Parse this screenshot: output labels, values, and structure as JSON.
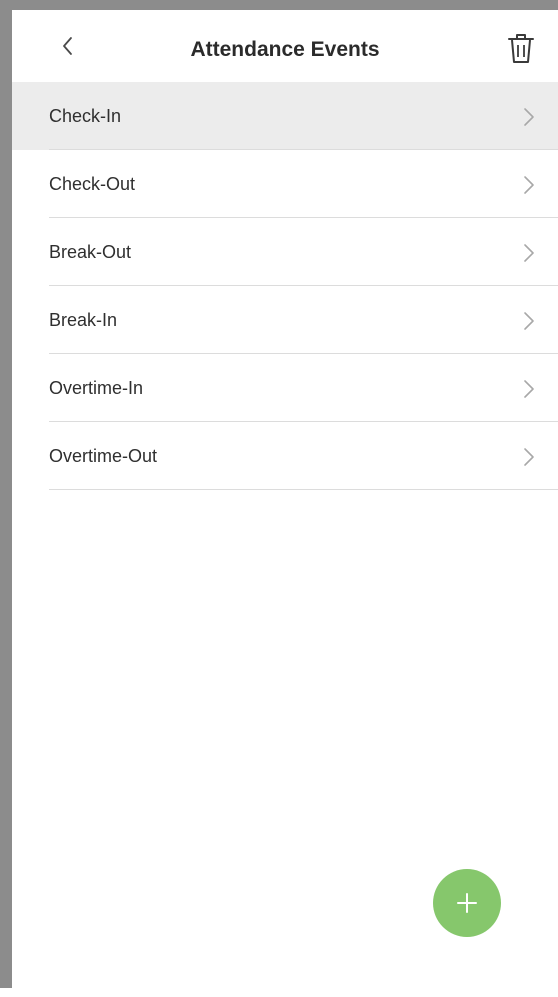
{
  "header": {
    "title": "Attendance Events",
    "back_icon": "chevron-left-icon",
    "delete_icon": "trash-icon"
  },
  "events": [
    {
      "label": "Check-In",
      "selected": true
    },
    {
      "label": "Check-Out",
      "selected": false
    },
    {
      "label": "Break-Out",
      "selected": false
    },
    {
      "label": "Break-In",
      "selected": false
    },
    {
      "label": "Overtime-In",
      "selected": false
    },
    {
      "label": "Overtime-Out",
      "selected": false
    }
  ],
  "fab": {
    "icon": "plus-icon",
    "color": "#86c76c"
  },
  "colors": {
    "selected_row": "#ececec",
    "divider": "#dcdcdc",
    "text": "#2f2f2f"
  }
}
